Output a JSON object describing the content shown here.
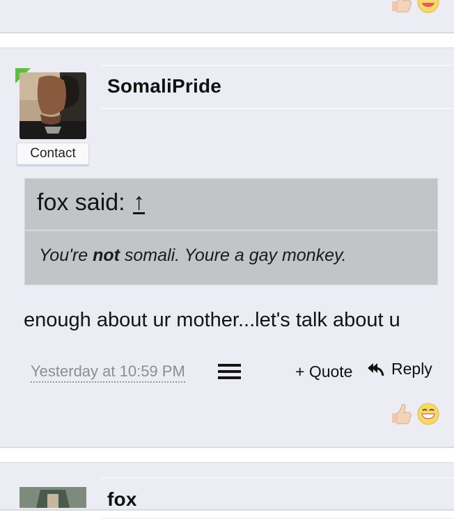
{
  "previous_post": {
    "reactions": [
      {
        "icon": "thumbs-up-icon"
      },
      {
        "icon": "laughing-emoji-icon"
      }
    ]
  },
  "post": {
    "author": "SomaliPride",
    "contact_label": "Contact",
    "quote": {
      "source": "fox said:",
      "jump_icon": "↑",
      "text_before": "You're ",
      "text_bold": "not",
      "text_after": " somali. Youre a gay monkey."
    },
    "message": "enough about ur mother...let's talk about u",
    "timestamp": "Yesterday at 10:59 PM",
    "actions": {
      "quote_label": "+ Quote",
      "reply_label": "Reply"
    },
    "reactions": [
      {
        "icon": "thumbs-up-icon"
      },
      {
        "icon": "laughing-emoji-icon"
      }
    ]
  },
  "next_post": {
    "author": "fox"
  },
  "colors": {
    "post_background": "#ececf4",
    "quote_background": "#c3c4c7",
    "online_indicator": "#5cbe3c",
    "timestamp": "#8e8e8e"
  }
}
